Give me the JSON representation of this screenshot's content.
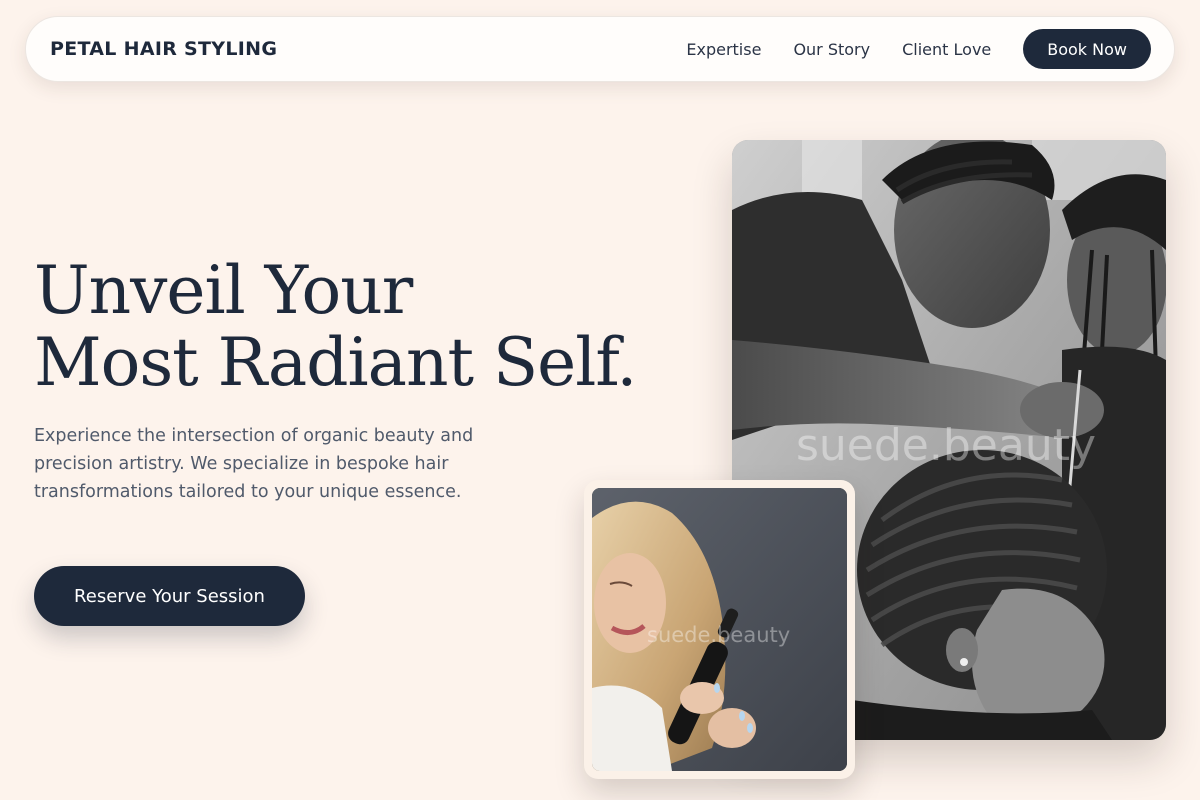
{
  "brand": {
    "name": "PETAL HAIR STYLING"
  },
  "nav": {
    "links": [
      "Expertise",
      "Our Story",
      "Client Love"
    ],
    "cta_label": "Book Now"
  },
  "hero": {
    "headline_line1": "Unveil Your",
    "headline_line2": "Most Radiant Self.",
    "subtext": "Experience the intersection of organic beauty and precision artistry. We specialize in bespoke hair transformations tailored to your unique essence.",
    "cta_label": "Reserve Your Session"
  },
  "images": {
    "main_watermark": "suede.beauty",
    "small_watermark": "suede.beauty"
  },
  "colors": {
    "background": "#fdf3ec",
    "navy": "#1e293b",
    "body_text": "#505a6b"
  }
}
